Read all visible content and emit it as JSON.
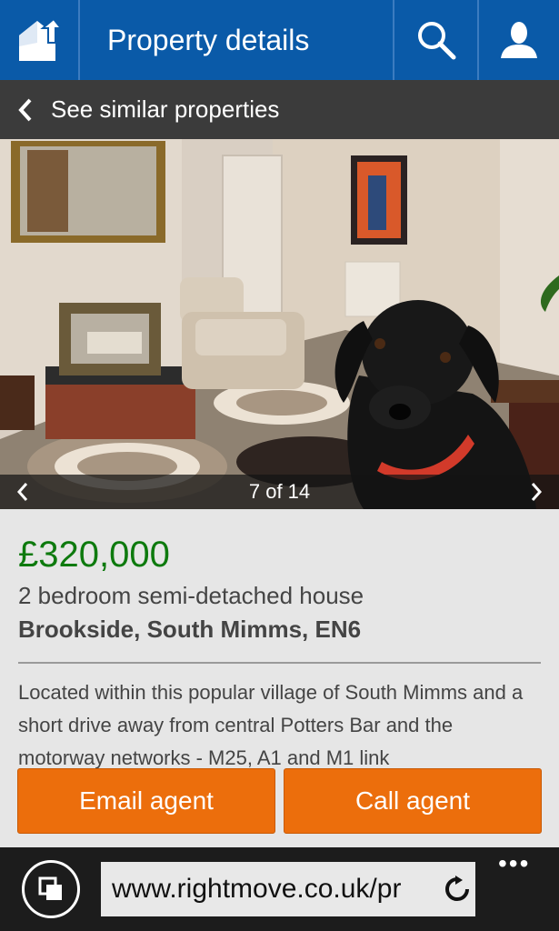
{
  "header": {
    "title": "Property details",
    "logo_icon": "house-logo-icon",
    "search_icon": "search-icon",
    "user_icon": "user-icon"
  },
  "subbar": {
    "label": "See similar properties",
    "icon": "chevron-left-icon"
  },
  "gallery": {
    "counter": "7 of 14",
    "prev_icon": "chevron-left-icon",
    "next_icon": "chevron-right-icon"
  },
  "listing": {
    "price": "£320,000",
    "type": "2 bedroom semi-detached house",
    "address": "Brookside, South Mimms, EN6",
    "description": "Located within this popular village of South Mimms and a short drive away from central Potters Bar and the motorway networks - M25, A1 and M1 link"
  },
  "actions": {
    "email_label": "Email agent",
    "call_label": "Call agent"
  },
  "browser": {
    "url": "www.rightmove.co.uk/pr",
    "more": "•••"
  },
  "colors": {
    "header_bg": "#0a5aa8",
    "price": "#0e7a0e",
    "button": "#ec6e0c",
    "subbar_bg": "#3b3b3b"
  }
}
